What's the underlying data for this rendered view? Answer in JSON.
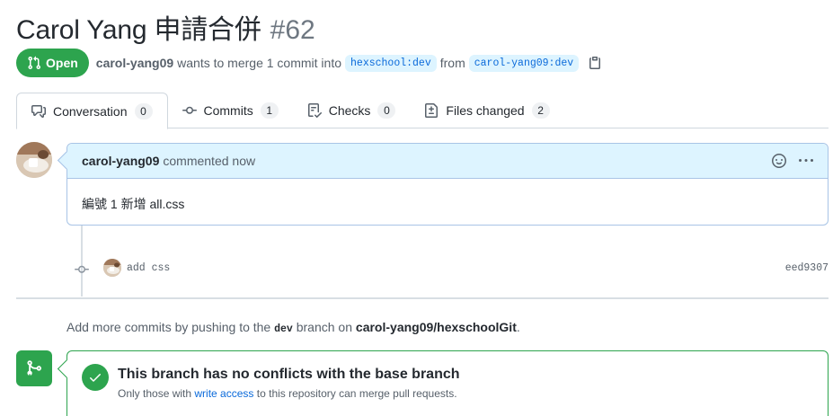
{
  "pull_request": {
    "title": "Carol Yang 申請合併",
    "number": "#62",
    "state": "Open",
    "author": "carol-yang09",
    "merge_text": "wants to merge 1 commit into",
    "base_branch": "hexschool:dev",
    "from_text": "from",
    "head_branch": "carol-yang09:dev"
  },
  "tabs": [
    {
      "label": "Conversation",
      "count": "0",
      "icon": "comment-discussion-icon",
      "selected": true
    },
    {
      "label": "Commits",
      "count": "1",
      "icon": "git-commit-icon"
    },
    {
      "label": "Checks",
      "count": "0",
      "icon": "checklist-icon"
    },
    {
      "label": "Files changed",
      "count": "2",
      "icon": "file-diff-icon"
    }
  ],
  "comment": {
    "author": "carol-yang09",
    "time": "commented now",
    "body": "編號 1 新增 all.css"
  },
  "commit": {
    "message": "add css",
    "sha": "eed9307"
  },
  "push_hint": {
    "prefix": "Add more commits by pushing to the",
    "branch": "dev",
    "middle": "branch on",
    "repo": "carol-yang09/hexschoolGit",
    "suffix": "."
  },
  "merge": {
    "title": "This branch has no conflicts with the base branch",
    "sub_prefix": "Only those with",
    "sub_link": "write access",
    "sub_suffix": "to this repository can merge pull requests."
  },
  "colors": {
    "open_green": "#2da44e",
    "link_blue": "#0969da",
    "branch_bg": "#ddf4ff"
  }
}
